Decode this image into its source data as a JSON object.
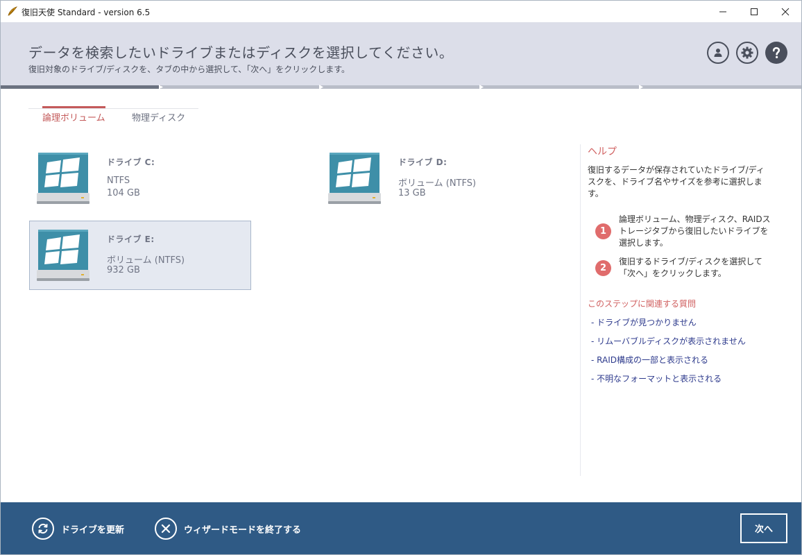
{
  "window": {
    "title": "復旧天使 Standard - version 6.5"
  },
  "header": {
    "title": "データを検索したいドライブまたはディスクを選択してください。",
    "subtitle": "復旧対象のドライブ/ディスクを、タブの中から選択して、「次へ」をクリックします。",
    "icons": [
      "account-icon",
      "gear-icon",
      "help-icon"
    ]
  },
  "progress": {
    "steps": 5,
    "current_step": 1
  },
  "tabs": [
    {
      "label": "論理ボリューム",
      "active": true
    },
    {
      "label": "物理ディスク",
      "active": false
    }
  ],
  "drives": [
    {
      "name": "ドライブ C:",
      "fs": "NTFS",
      "size": "104 GB",
      "selected": false
    },
    {
      "name": "ドライブ D:",
      "fs": "ボリューム (NTFS)",
      "size": "13 GB",
      "selected": false
    },
    {
      "name": "ドライブ E:",
      "fs": "ボリューム (NTFS)",
      "size": "932 GB",
      "selected": true
    }
  ],
  "help": {
    "title": "ヘルプ",
    "description": "復旧するデータが保存されていたドライブ/ディスクを、ドライブ名やサイズを参考に選択します。",
    "steps": [
      {
        "num": "1",
        "text": "論理ボリューム、物理ディスク、RAIDストレージタブから復旧したいドライブを選択します。"
      },
      {
        "num": "2",
        "text": "復旧するドライブ/ディスクを選択して「次へ」をクリックします。"
      }
    ],
    "faq_title": "このステップに関連する質問",
    "faq": [
      "- ドライブが見つかりません",
      "- リムーバブルディスクが表示されません",
      "- RAID構成の一部と表示される",
      "- 不明なフォーマットと表示される"
    ]
  },
  "footer": {
    "refresh_label": "ドライブを更新",
    "exit_label": "ウィザードモードを終了する",
    "next_label": "次へ"
  },
  "colors": {
    "header_bg": "#dcdee9",
    "footer_bg": "#2f5a85",
    "accent_red": "#c45a5a",
    "link": "#2d3a8c",
    "drive_icon": "#3e8fa8"
  }
}
